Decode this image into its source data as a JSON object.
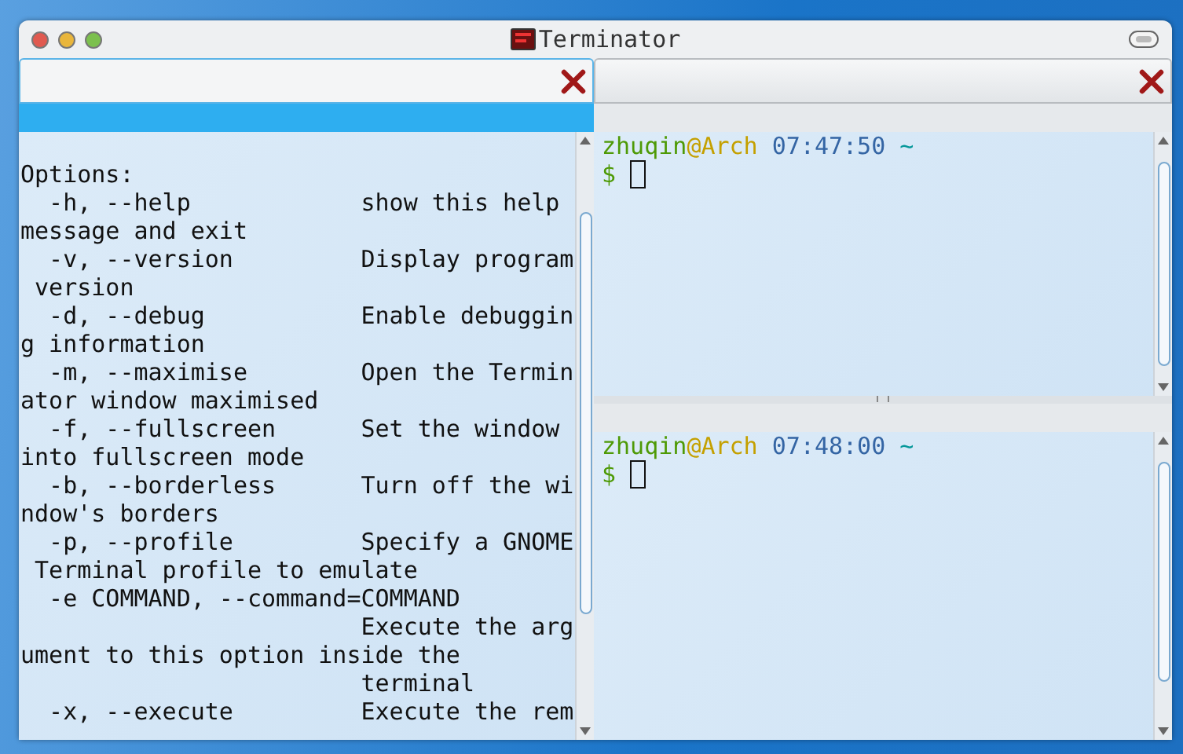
{
  "window": {
    "title": "Terminator"
  },
  "left_pane": {
    "focused": true,
    "lines": [
      "Options:",
      "  -h, --help            show this help",
      "message and exit",
      "  -v, --version         Display program",
      " version",
      "  -d, --debug           Enable debuggin",
      "g information",
      "  -m, --maximise        Open the Termin",
      "ator window maximised",
      "  -f, --fullscreen      Set the window",
      "into fullscreen mode",
      "  -b, --borderless      Turn off the wi",
      "ndow's borders",
      "  -p, --profile         Specify a GNOME",
      " Terminal profile to emulate",
      "  -e COMMAND, --command=COMMAND",
      "                        Execute the arg",
      "ument to this option inside the",
      "                        terminal",
      "  -x, --execute         Execute the rem"
    ]
  },
  "right_panes": [
    {
      "focused": false,
      "prompt": [
        {
          "text": "zhuqin",
          "color": "#4e9a06"
        },
        {
          "text": "@Arch",
          "color": "#c4a000"
        },
        {
          "text": " 07:47:50",
          "color": "#3465a4"
        },
        {
          "text": " ~",
          "color": "#06989a"
        }
      ],
      "symbol": "$"
    },
    {
      "focused": false,
      "prompt": [
        {
          "text": "zhuqin",
          "color": "#4e9a06"
        },
        {
          "text": "@Arch",
          "color": "#c4a000"
        },
        {
          "text": " 07:48:00",
          "color": "#3465a4"
        },
        {
          "text": " ~",
          "color": "#06989a"
        }
      ],
      "symbol": "$"
    }
  ]
}
